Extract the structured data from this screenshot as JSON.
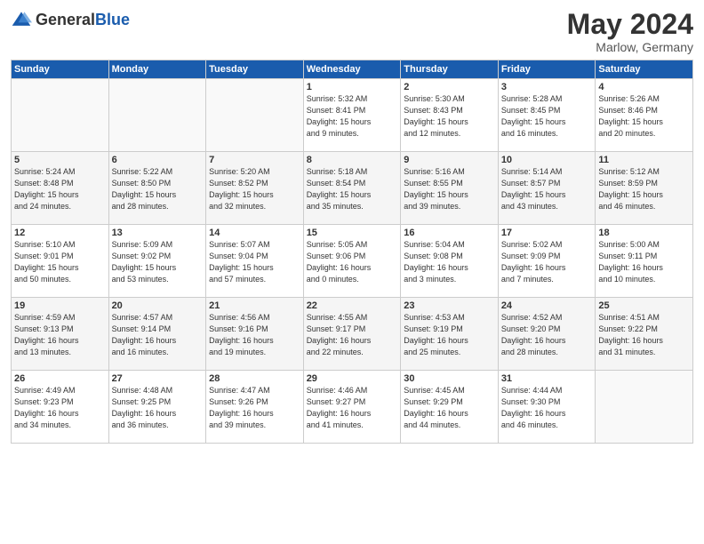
{
  "header": {
    "logo_general": "General",
    "logo_blue": "Blue",
    "title": "May 2024",
    "subtitle": "Marlow, Germany"
  },
  "weekdays": [
    "Sunday",
    "Monday",
    "Tuesday",
    "Wednesday",
    "Thursday",
    "Friday",
    "Saturday"
  ],
  "weeks": [
    [
      {
        "day": "",
        "info": ""
      },
      {
        "day": "",
        "info": ""
      },
      {
        "day": "",
        "info": ""
      },
      {
        "day": "1",
        "info": "Sunrise: 5:32 AM\nSunset: 8:41 PM\nDaylight: 15 hours\nand 9 minutes."
      },
      {
        "day": "2",
        "info": "Sunrise: 5:30 AM\nSunset: 8:43 PM\nDaylight: 15 hours\nand 12 minutes."
      },
      {
        "day": "3",
        "info": "Sunrise: 5:28 AM\nSunset: 8:45 PM\nDaylight: 15 hours\nand 16 minutes."
      },
      {
        "day": "4",
        "info": "Sunrise: 5:26 AM\nSunset: 8:46 PM\nDaylight: 15 hours\nand 20 minutes."
      }
    ],
    [
      {
        "day": "5",
        "info": "Sunrise: 5:24 AM\nSunset: 8:48 PM\nDaylight: 15 hours\nand 24 minutes."
      },
      {
        "day": "6",
        "info": "Sunrise: 5:22 AM\nSunset: 8:50 PM\nDaylight: 15 hours\nand 28 minutes."
      },
      {
        "day": "7",
        "info": "Sunrise: 5:20 AM\nSunset: 8:52 PM\nDaylight: 15 hours\nand 32 minutes."
      },
      {
        "day": "8",
        "info": "Sunrise: 5:18 AM\nSunset: 8:54 PM\nDaylight: 15 hours\nand 35 minutes."
      },
      {
        "day": "9",
        "info": "Sunrise: 5:16 AM\nSunset: 8:55 PM\nDaylight: 15 hours\nand 39 minutes."
      },
      {
        "day": "10",
        "info": "Sunrise: 5:14 AM\nSunset: 8:57 PM\nDaylight: 15 hours\nand 43 minutes."
      },
      {
        "day": "11",
        "info": "Sunrise: 5:12 AM\nSunset: 8:59 PM\nDaylight: 15 hours\nand 46 minutes."
      }
    ],
    [
      {
        "day": "12",
        "info": "Sunrise: 5:10 AM\nSunset: 9:01 PM\nDaylight: 15 hours\nand 50 minutes."
      },
      {
        "day": "13",
        "info": "Sunrise: 5:09 AM\nSunset: 9:02 PM\nDaylight: 15 hours\nand 53 minutes."
      },
      {
        "day": "14",
        "info": "Sunrise: 5:07 AM\nSunset: 9:04 PM\nDaylight: 15 hours\nand 57 minutes."
      },
      {
        "day": "15",
        "info": "Sunrise: 5:05 AM\nSunset: 9:06 PM\nDaylight: 16 hours\nand 0 minutes."
      },
      {
        "day": "16",
        "info": "Sunrise: 5:04 AM\nSunset: 9:08 PM\nDaylight: 16 hours\nand 3 minutes."
      },
      {
        "day": "17",
        "info": "Sunrise: 5:02 AM\nSunset: 9:09 PM\nDaylight: 16 hours\nand 7 minutes."
      },
      {
        "day": "18",
        "info": "Sunrise: 5:00 AM\nSunset: 9:11 PM\nDaylight: 16 hours\nand 10 minutes."
      }
    ],
    [
      {
        "day": "19",
        "info": "Sunrise: 4:59 AM\nSunset: 9:13 PM\nDaylight: 16 hours\nand 13 minutes."
      },
      {
        "day": "20",
        "info": "Sunrise: 4:57 AM\nSunset: 9:14 PM\nDaylight: 16 hours\nand 16 minutes."
      },
      {
        "day": "21",
        "info": "Sunrise: 4:56 AM\nSunset: 9:16 PM\nDaylight: 16 hours\nand 19 minutes."
      },
      {
        "day": "22",
        "info": "Sunrise: 4:55 AM\nSunset: 9:17 PM\nDaylight: 16 hours\nand 22 minutes."
      },
      {
        "day": "23",
        "info": "Sunrise: 4:53 AM\nSunset: 9:19 PM\nDaylight: 16 hours\nand 25 minutes."
      },
      {
        "day": "24",
        "info": "Sunrise: 4:52 AM\nSunset: 9:20 PM\nDaylight: 16 hours\nand 28 minutes."
      },
      {
        "day": "25",
        "info": "Sunrise: 4:51 AM\nSunset: 9:22 PM\nDaylight: 16 hours\nand 31 minutes."
      }
    ],
    [
      {
        "day": "26",
        "info": "Sunrise: 4:49 AM\nSunset: 9:23 PM\nDaylight: 16 hours\nand 34 minutes."
      },
      {
        "day": "27",
        "info": "Sunrise: 4:48 AM\nSunset: 9:25 PM\nDaylight: 16 hours\nand 36 minutes."
      },
      {
        "day": "28",
        "info": "Sunrise: 4:47 AM\nSunset: 9:26 PM\nDaylight: 16 hours\nand 39 minutes."
      },
      {
        "day": "29",
        "info": "Sunrise: 4:46 AM\nSunset: 9:27 PM\nDaylight: 16 hours\nand 41 minutes."
      },
      {
        "day": "30",
        "info": "Sunrise: 4:45 AM\nSunset: 9:29 PM\nDaylight: 16 hours\nand 44 minutes."
      },
      {
        "day": "31",
        "info": "Sunrise: 4:44 AM\nSunset: 9:30 PM\nDaylight: 16 hours\nand 46 minutes."
      },
      {
        "day": "",
        "info": ""
      }
    ]
  ]
}
